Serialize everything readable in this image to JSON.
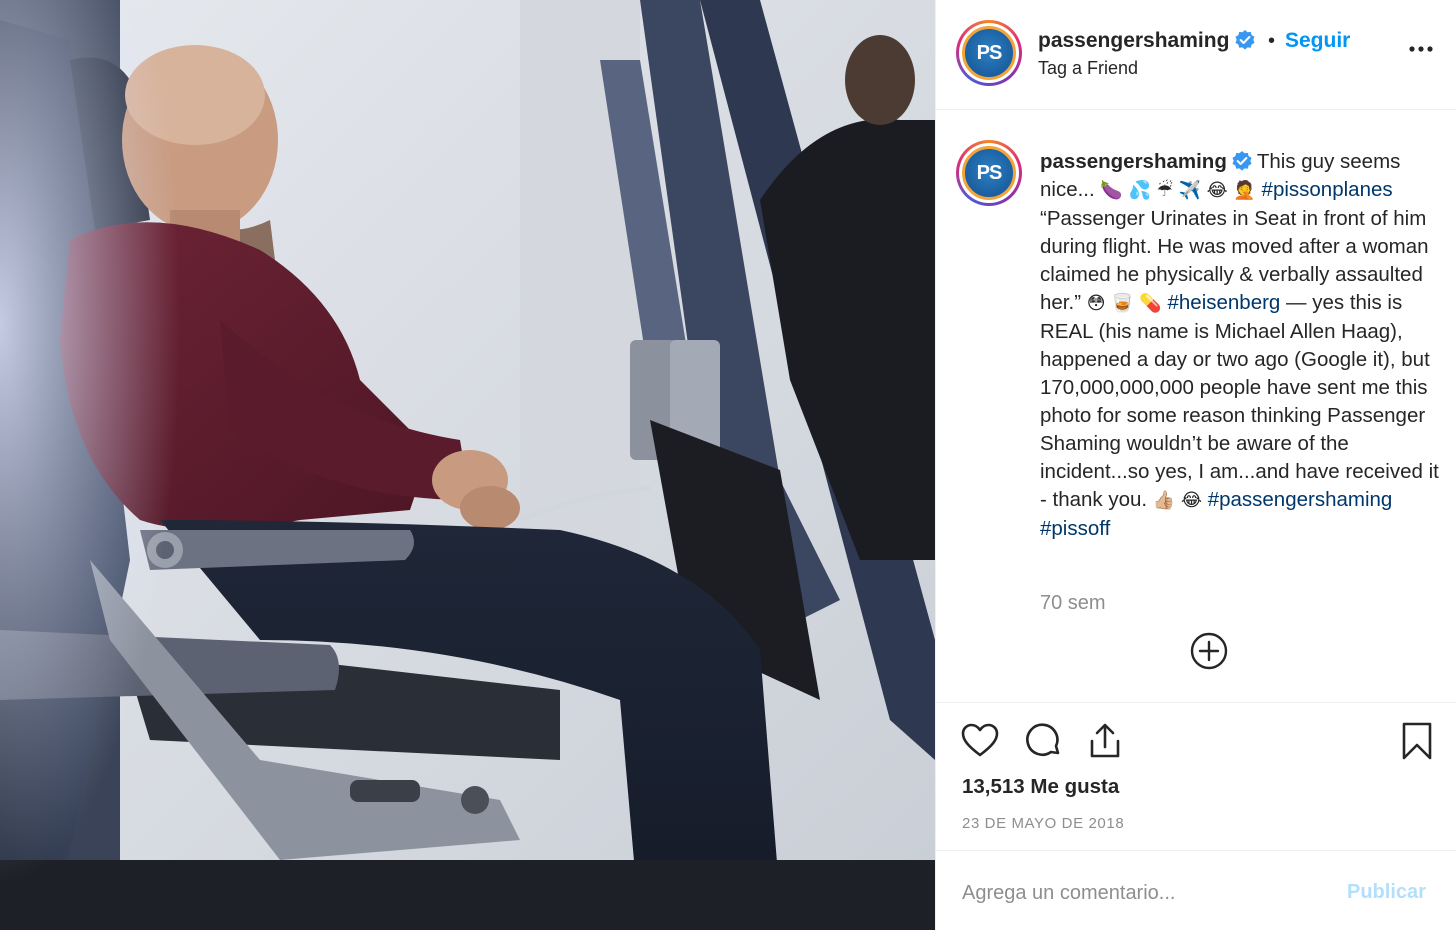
{
  "post": {
    "username": "passengershaming",
    "follow_label": "Seguir",
    "separator": "•",
    "location": "Tag a Friend",
    "avatar_text": "PS"
  },
  "caption": {
    "username": "passengershaming",
    "text_1": "This guy seems nice...",
    "emoji_1": "🍆 💦 ☔ ✈️ 😂 🤦",
    "hashtag_1": "#pissonplanes",
    "text_2": "“Passenger Urinates in Seat in front of him during flight. He was moved after a woman claimed he physically & verbally assaulted her.”",
    "emoji_2": "😳 🥃 💊",
    "hashtag_2": "#heisenberg",
    "text_3": "— yes this is REAL (his name is Michael Allen Haag), happened a day or two ago (Google it), but 170,000,000,000 people have sent me this photo for some reason thinking Passenger Shaming wouldn’t be aware of the incident...so yes, I am...and have received it - thank you.",
    "emoji_3": "👍🏼 😂",
    "hashtag_3": "#passengershaming",
    "hashtag_4": "#pissoff"
  },
  "meta": {
    "time_ago": "70 sem",
    "likes": "13,513 Me gusta",
    "date": "23 DE MAYO DE 2018"
  },
  "comment": {
    "placeholder": "Agrega un comentario...",
    "publish_label": "Publicar"
  },
  "icons": {
    "verified": "verified-badge-icon",
    "more": "more-options-icon",
    "load_more": "plus-circle-icon",
    "like": "heart-icon",
    "comment": "comment-icon",
    "share": "share-icon",
    "save": "bookmark-icon"
  },
  "colors": {
    "link": "#0095f6",
    "hashtag": "#00376b",
    "muted": "#8e8e8e",
    "publish_disabled": "#b2dffc"
  }
}
